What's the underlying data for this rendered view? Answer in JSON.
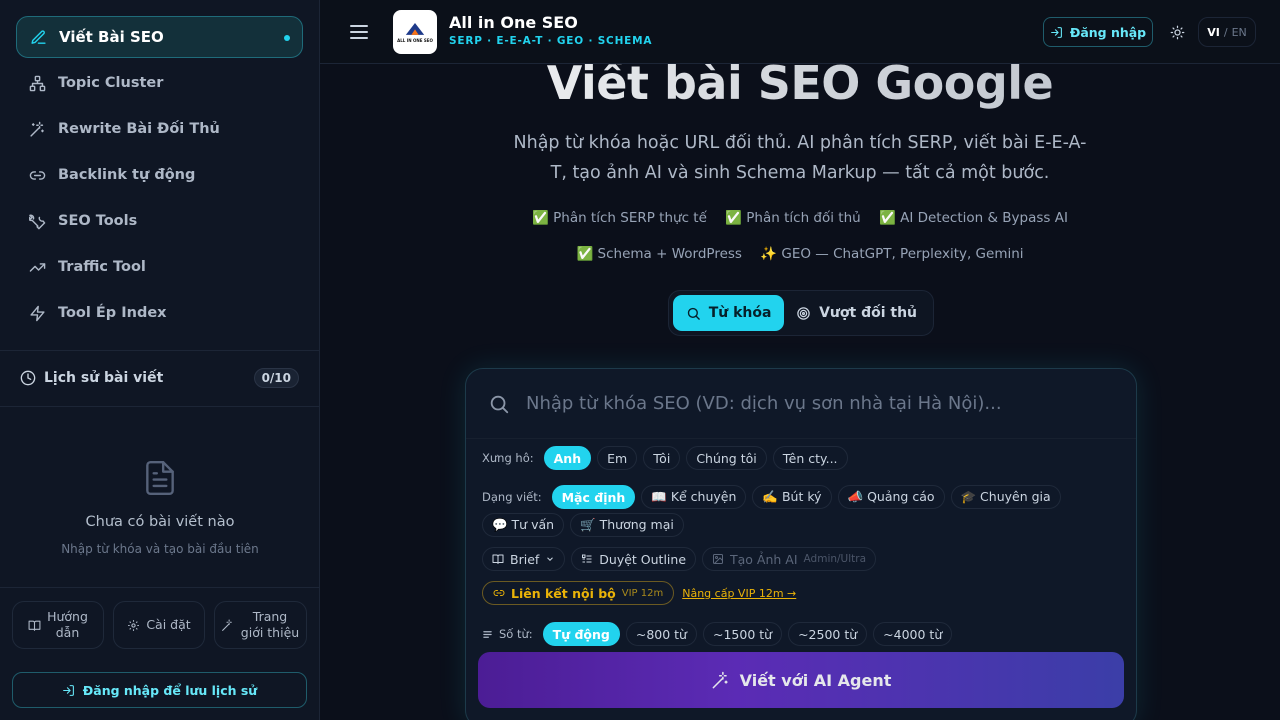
{
  "sidebar": {
    "nav": [
      {
        "label": "Viết Bài SEO",
        "icon": "pen-icon",
        "active": true
      },
      {
        "label": "Topic Cluster",
        "icon": "sitemap-icon"
      },
      {
        "label": "Rewrite Bài Đối Thủ",
        "icon": "magic-wand-icon"
      },
      {
        "label": "Backlink tự động",
        "icon": "link-icon"
      },
      {
        "label": "SEO Tools",
        "icon": "wrench-icon"
      },
      {
        "label": "Traffic Tool",
        "icon": "trending-up-icon"
      },
      {
        "label": "Tool Ép Index",
        "icon": "lightning-icon"
      }
    ],
    "history": {
      "title": "Lịch sử bài viết",
      "count": "0/10"
    },
    "empty": {
      "title": "Chưa có bài viết nào",
      "subtitle": "Nhập từ khóa và tạo bài đầu tiên"
    },
    "footer": {
      "guide": "Hướng dẫn",
      "settings": "Cài đặt",
      "intro": "Trang giới thiệu"
    },
    "login": "Đăng nhập để lưu lịch sử"
  },
  "topbar": {
    "brand": "All in One SEO",
    "tagline": "SERP · E-E-A-T · GEO · SCHEMA",
    "logo_text": "ALL IN ONE SEO",
    "login": "Đăng nhập",
    "lang_active": "VI",
    "lang_sep": "/",
    "lang_other": "EN"
  },
  "hero": {
    "title": "Viết bài SEO Google",
    "subtitle": "Nhập từ khóa hoặc URL đối thủ. AI phân tích SERP, viết bài E-E-A-T, tạo ảnh AI và sinh Schema Markup — tất cả một bước.",
    "features": [
      "✅ Phân tích SERP thực tế",
      "✅ Phân tích đối thủ",
      "✅ AI Detection & Bypass AI",
      "✅ Schema + WordPress",
      "✨ GEO — ChatGPT, Perplexity, Gemini"
    ]
  },
  "modes": {
    "keyword": "Từ khóa",
    "competitor": "Vượt đối thủ"
  },
  "form": {
    "search_placeholder": "Nhập từ khóa SEO (VD: dịch vụ sơn nhà tại Hà Nội)...",
    "pronoun_label": "Xưng hô:",
    "pronouns": [
      "Anh",
      "Em",
      "Tôi",
      "Chúng tôi",
      "Tên cty..."
    ],
    "style_label": "Dạng viết:",
    "styles": [
      "Mặc định",
      "📖 Kể chuyện",
      "✍️ Bút ký",
      "📣 Quảng cáo",
      "🎓 Chuyên gia",
      "💬 Tư vấn",
      "🛒 Thương mại"
    ],
    "brief": "Brief",
    "outline": "Duyệt Outline",
    "ai_image": "Tạo Ảnh AI",
    "ai_image_note": "Admin/Ultra",
    "internal_link": "Liên kết nội bộ",
    "internal_link_note": "VIP 12m",
    "upgrade": "Nâng cấp VIP 12m →",
    "words_label": "Số từ:",
    "words": [
      "Tự động",
      "~800 từ",
      "~1500 từ",
      "~2500 từ",
      "~4000 từ"
    ],
    "submit": "Viết với AI Agent"
  },
  "colors": {
    "accent": "#22d3ee",
    "gold": "#eab308",
    "button_from": "#4c1d95",
    "button_to": "#3b3ea8"
  }
}
